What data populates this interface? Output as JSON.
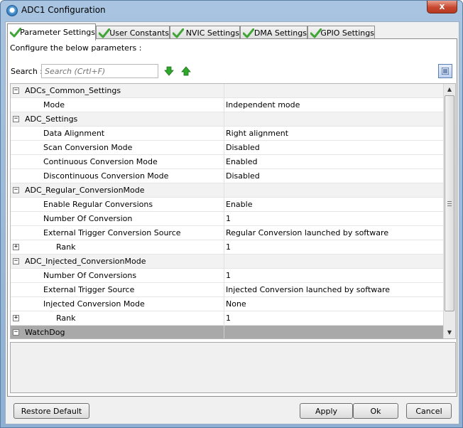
{
  "window": {
    "title": "ADC1 Configuration",
    "close_label": "x"
  },
  "tabs": [
    {
      "label": "Parameter Settings",
      "active": true
    },
    {
      "label": "User Constants",
      "active": false
    },
    {
      "label": "NVIC Settings",
      "active": false
    },
    {
      "label": "DMA Settings",
      "active": false
    },
    {
      "label": "GPIO Settings",
      "active": false
    }
  ],
  "panel": {
    "configure_text": "Configure the below parameters :",
    "search_label": "Search :",
    "search_placeholder": "Search (Crtl+F)"
  },
  "rows": [
    {
      "type": "group",
      "name": "ADCs_Common_Settings",
      "value": "",
      "toggle": "−"
    },
    {
      "type": "item",
      "name": "Mode",
      "value": "Independent mode",
      "indent": 1
    },
    {
      "type": "group",
      "name": "ADC_Settings",
      "value": "",
      "toggle": "−"
    },
    {
      "type": "item",
      "name": "Data Alignment",
      "value": "Right alignment",
      "indent": 1
    },
    {
      "type": "item",
      "name": "Scan Conversion Mode",
      "value": "Disabled",
      "indent": 1
    },
    {
      "type": "item",
      "name": "Continuous Conversion Mode",
      "value": "Enabled",
      "indent": 1
    },
    {
      "type": "item",
      "name": "Discontinuous Conversion Mode",
      "value": "Disabled",
      "indent": 1
    },
    {
      "type": "group",
      "name": "ADC_Regular_ConversionMode",
      "value": "",
      "toggle": "−"
    },
    {
      "type": "item",
      "name": "Enable Regular Conversions",
      "value": "Enable",
      "indent": 1
    },
    {
      "type": "item",
      "name": "Number Of Conversion",
      "value": "1",
      "indent": 1
    },
    {
      "type": "item",
      "name": "External Trigger Conversion Source",
      "value": "Regular Conversion launched by software",
      "indent": 1
    },
    {
      "type": "subgroup",
      "name": "Rank",
      "value": "1",
      "indent": 2,
      "toggle": "+"
    },
    {
      "type": "group",
      "name": "ADC_Injected_ConversionMode",
      "value": "",
      "toggle": "−"
    },
    {
      "type": "item",
      "name": "Number Of Conversions",
      "value": "1",
      "indent": 1
    },
    {
      "type": "item",
      "name": "External Trigger Source",
      "value": "Injected Conversion launched by software",
      "indent": 1
    },
    {
      "type": "item",
      "name": "Injected Conversion Mode",
      "value": "None",
      "indent": 1
    },
    {
      "type": "subgroup",
      "name": "Rank",
      "value": "1",
      "indent": 2,
      "toggle": "+"
    },
    {
      "type": "selected",
      "name": "WatchDog",
      "value": "",
      "toggle": "−"
    }
  ],
  "buttons": {
    "restore_default": "Restore Default",
    "apply": "Apply",
    "ok": "Ok",
    "cancel": "Cancel"
  },
  "colors": {
    "check_green": "#3fa535",
    "arrow_green": "#2ea82a"
  }
}
